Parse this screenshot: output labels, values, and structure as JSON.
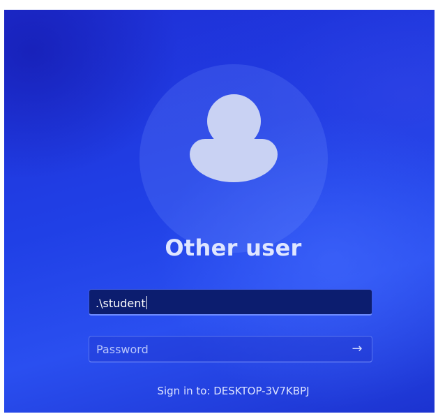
{
  "account": {
    "name": "Other user"
  },
  "username_field": {
    "value": ".\\student"
  },
  "password_field": {
    "placeholder": "Password"
  },
  "submit": {
    "icon": "arrow-right-icon",
    "glyph": "→"
  },
  "sign_in_target": "Sign in to: DESKTOP-3V7KBPJ",
  "colors": {
    "background": "#2040e6",
    "username_field_bg": "#0c1d6f",
    "avatar": "#c9d2f3"
  }
}
